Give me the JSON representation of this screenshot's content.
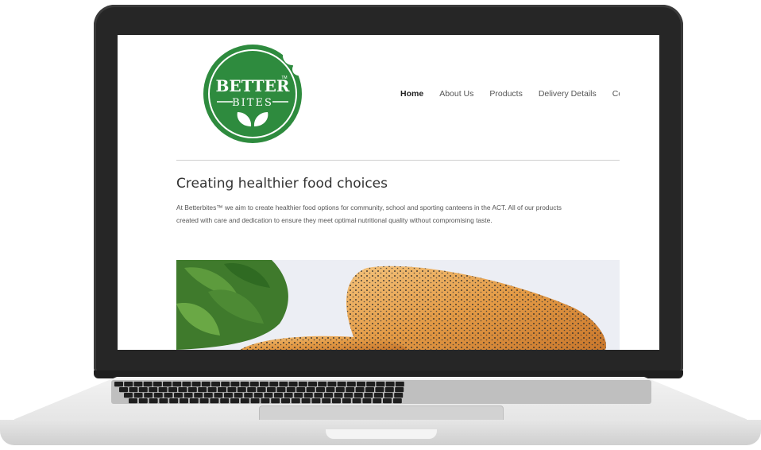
{
  "site": {
    "logo": {
      "top_text": "BETTER",
      "bottom_text": "BITES",
      "trademark": "TM",
      "color": "#2e8b3e"
    },
    "nav": {
      "items": [
        {
          "label": "Home",
          "active": true
        },
        {
          "label": "About Us",
          "active": false
        },
        {
          "label": "Products",
          "active": false
        },
        {
          "label": "Delivery Details",
          "active": false
        },
        {
          "label": "Cont",
          "active": false
        }
      ]
    },
    "main": {
      "heading": "Creating healthier food choices",
      "intro_line1": "At Betterbites™ we aim to create healthier food options for community, school and sporting canteens in the ACT. All of our products",
      "intro_line2": "created with care and dedication to ensure they meet optimal nutritional quality without compromising taste."
    },
    "hero_image": {
      "subject": "poppy-seed pastry with parsley garnish"
    }
  },
  "device": {
    "type": "laptop",
    "bezel_color": "#262626",
    "body_color": "#e4e4e4"
  }
}
